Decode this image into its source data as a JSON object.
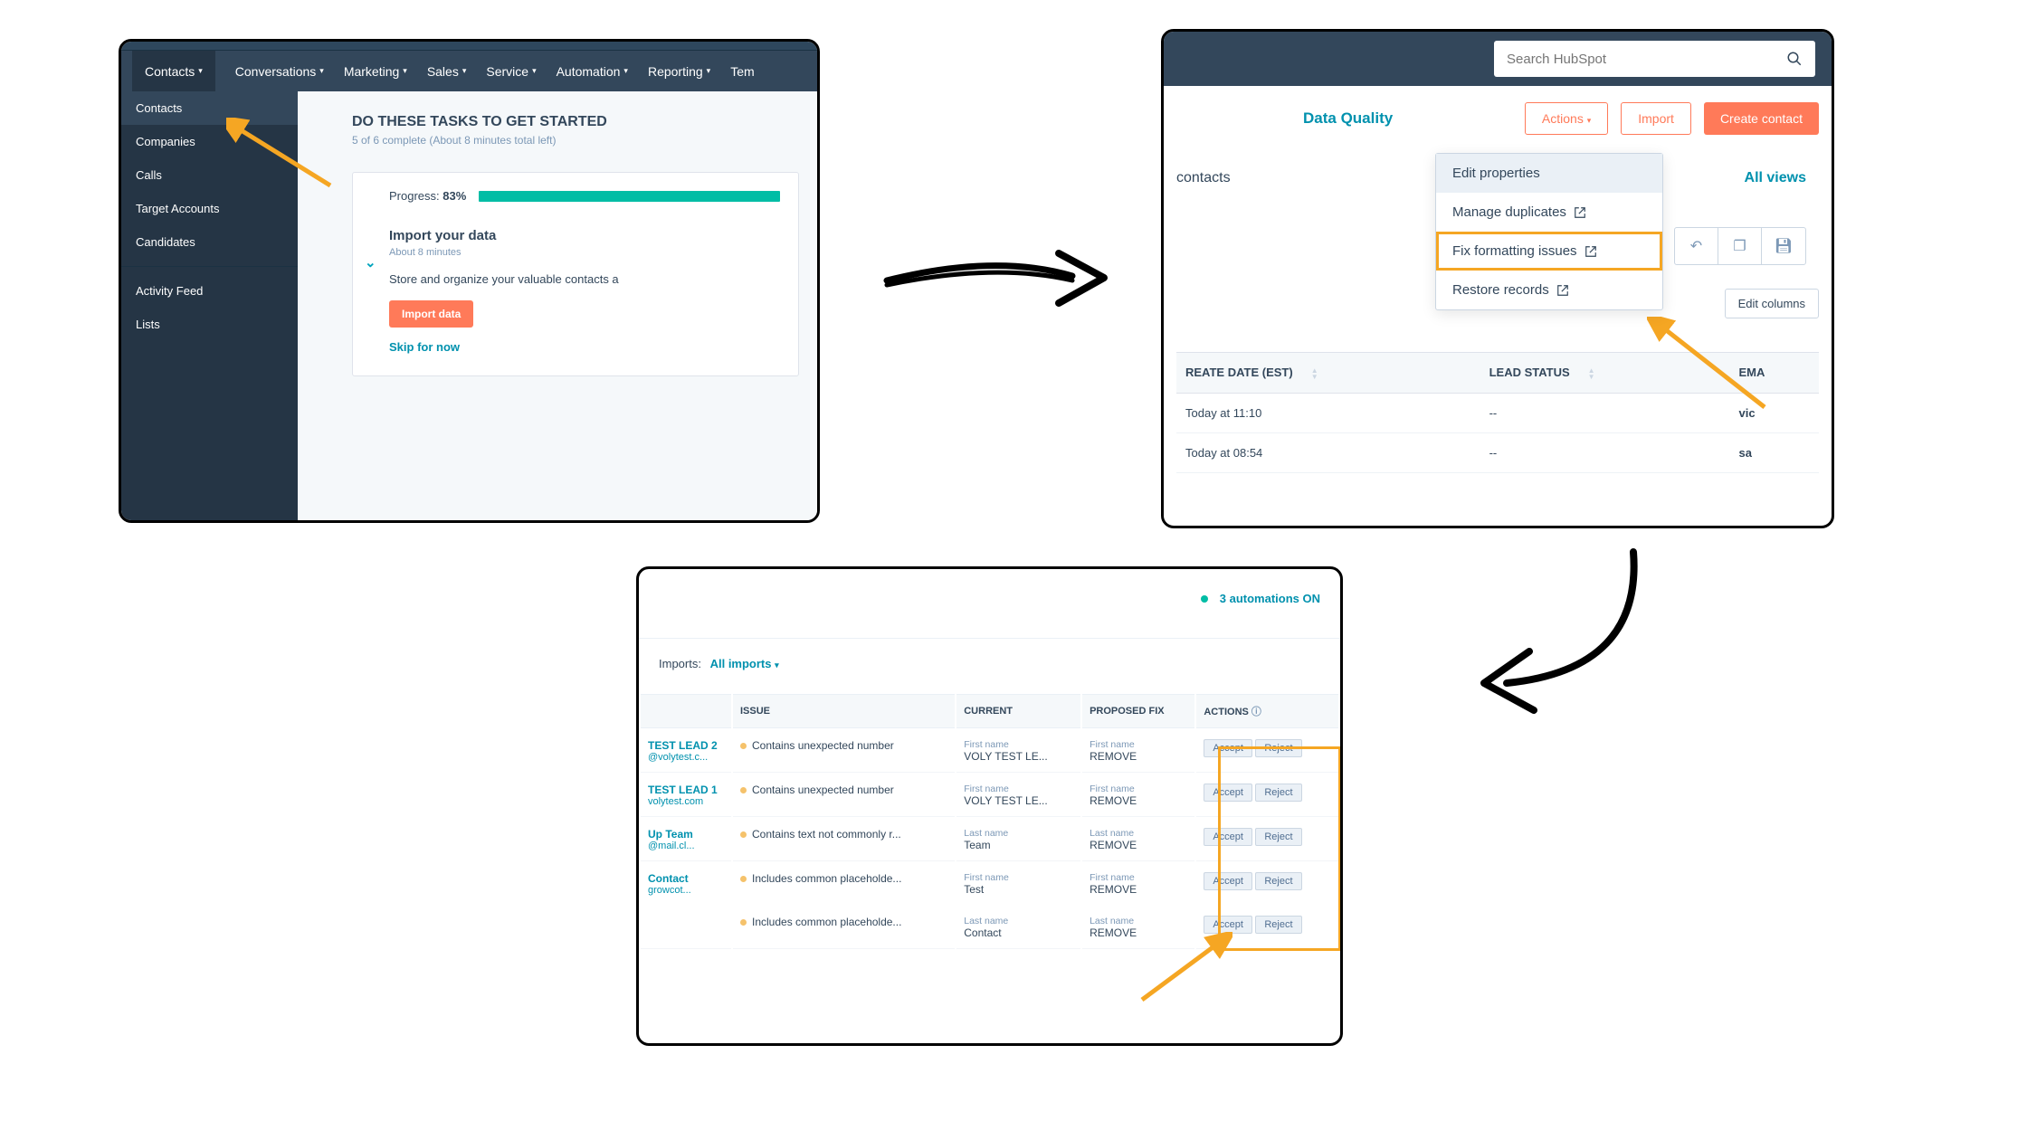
{
  "panel1": {
    "nav": [
      "Contacts",
      "Conversations",
      "Marketing",
      "Sales",
      "Service",
      "Automation",
      "Reporting",
      "Tem"
    ],
    "side_top": [
      "Contacts",
      "Companies",
      "Calls",
      "Target Accounts",
      "Candidates"
    ],
    "side_bottom": [
      "Activity Feed",
      "Lists"
    ],
    "heading": "DO THESE TASKS TO GET STARTED",
    "sub": "5 of 6 complete (About 8 minutes total left)",
    "progress_label": "Progress:",
    "progress_pct": "83%",
    "card_title": "Import your data",
    "card_about": "About 8 minutes",
    "card_desc": "Store and organize your valuable contacts a",
    "import_btn": "Import data",
    "skip": "Skip for now"
  },
  "panel2": {
    "search_ph": "Search HubSpot",
    "data_quality": "Data Quality",
    "actions_btn": "Actions",
    "import_btn": "Import",
    "create_btn": "Create contact",
    "contacts_label": "contacts",
    "all_views": "All views",
    "edit_columns": "Edit columns",
    "dropdown": [
      "Edit properties",
      "Manage duplicates",
      "Fix formatting issues",
      "Restore records"
    ],
    "th1": "REATE DATE (EST)",
    "th2": "LEAD STATUS",
    "th3": "EMA",
    "rows": [
      {
        "date": "Today at 11:10",
        "lead": "--",
        "email": "vic"
      },
      {
        "date": "Today at 08:54",
        "lead": "--",
        "email": "sa"
      }
    ]
  },
  "panel3": {
    "automations": "3 automations ON",
    "imports_label": "Imports:",
    "imports_sel": "All imports",
    "th_issue": "ISSUE",
    "th_current": "CURRENT",
    "th_proposed": "PROPOSED FIX",
    "th_actions": "ACTIONS",
    "actions_help_icon": "ⓘ",
    "accept": "Accept",
    "reject": "Reject",
    "rows": [
      {
        "name": "TEST LEAD 2",
        "sub": "@volytest.c...",
        "issue": "Contains unexpected number",
        "cl": "First name",
        "cv": "VOLY TEST LE...",
        "pl": "First name",
        "pv": "REMOVE"
      },
      {
        "name": "TEST LEAD 1",
        "sub": "volytest.com",
        "issue": "Contains unexpected number",
        "cl": "First name",
        "cv": "VOLY TEST LE...",
        "pl": "First name",
        "pv": "REMOVE"
      },
      {
        "name": "Up Team",
        "sub": "@mail.cl...",
        "issue": "Contains text not commonly r...",
        "cl": "Last name",
        "cv": "Team",
        "pl": "Last name",
        "pv": "REMOVE"
      },
      {
        "name": "Contact",
        "sub": "growcot...",
        "issue": "Includes common placeholde...",
        "cl": "First name",
        "cv": "Test",
        "pl": "First name",
        "pv": "REMOVE"
      },
      {
        "name": "",
        "sub": "",
        "issue": "Includes common placeholde...",
        "cl": "Last name",
        "cv": "Contact",
        "pl": "Last name",
        "pv": "REMOVE"
      }
    ]
  }
}
